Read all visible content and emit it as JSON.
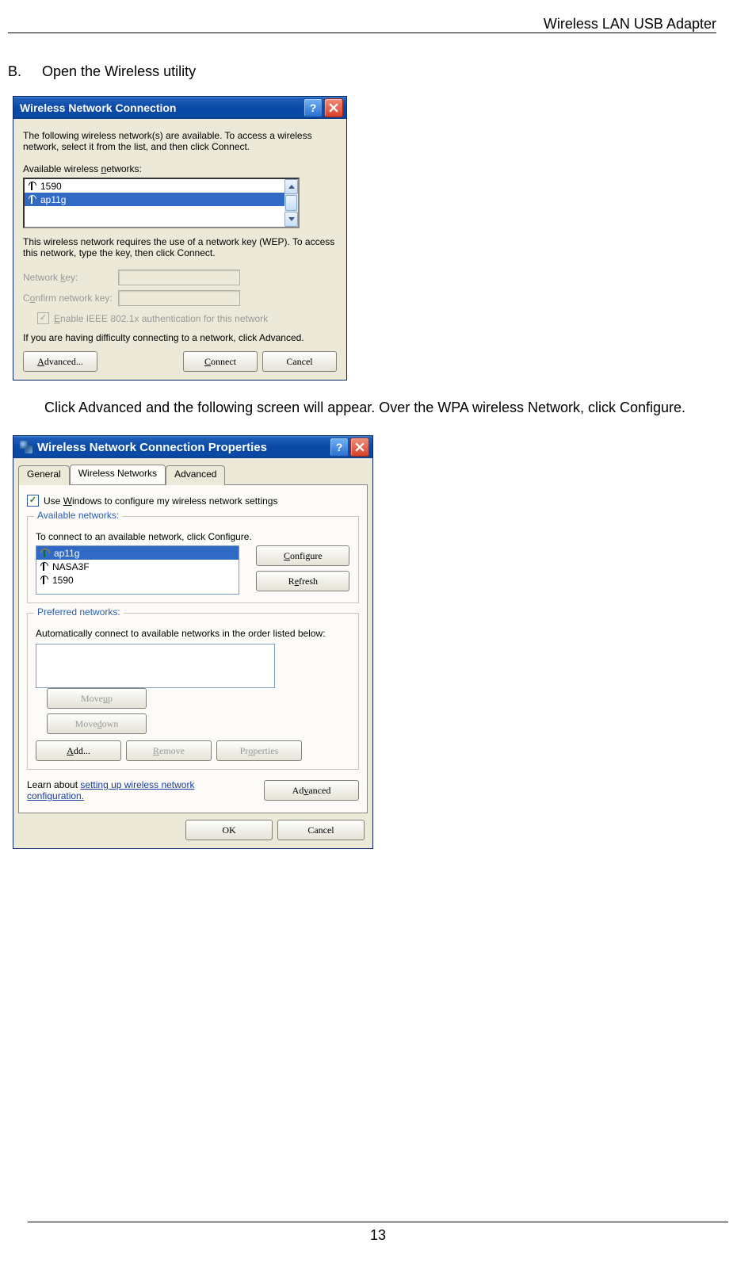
{
  "header": {
    "title": "Wireless LAN USB Adapter"
  },
  "section": {
    "letter": "B.",
    "text": "Open the Wireless utility"
  },
  "instruction": "Click Advanced and the following screen will appear. Over the WPA wireless Network, click Configure.",
  "footer": {
    "page": "13"
  },
  "dialog1": {
    "title": "Wireless Network Connection",
    "intro": "The following wireless network(s) are available. To access a wireless network, select it from the list, and then click Connect.",
    "available_label": "Available wireless networks:",
    "networks": [
      "1590",
      "ap11g"
    ],
    "wep_text": "This wireless network requires the use of a network key (WEP). To access this network, type the key, then click Connect.",
    "netkey_label": "Network key:",
    "confirm_label": "Confirm network key:",
    "enable_ieee": "Enable IEEE 802.1x authentication for this network",
    "difficulty": "If you are having difficulty connecting to a network, click Advanced.",
    "buttons": {
      "advanced": "Advanced...",
      "connect": "Connect",
      "cancel": "Cancel"
    }
  },
  "dialog2": {
    "title": "Wireless Network Connection Properties",
    "tabs": [
      "General",
      "Wireless Networks",
      "Advanced"
    ],
    "use_windows": "Use Windows to configure my wireless network settings",
    "group_available": {
      "legend": "Available networks:",
      "desc": "To connect to an available network, click Configure.",
      "items": [
        "ap11g",
        "NASA3F",
        "1590"
      ],
      "configure": "Configure",
      "refresh": "Refresh"
    },
    "group_preferred": {
      "legend": "Preferred networks:",
      "desc": "Automatically connect to available networks in the order listed below:",
      "moveup": "Move up",
      "movedown": "Move down",
      "add": "Add...",
      "remove": "Remove",
      "properties": "Properties"
    },
    "learn_prefix": "Learn about ",
    "learn_link1": "setting up wireless network",
    "learn_link2": "configuration.",
    "advanced_btn": "Advanced",
    "ok": "OK",
    "cancel": "Cancel"
  }
}
